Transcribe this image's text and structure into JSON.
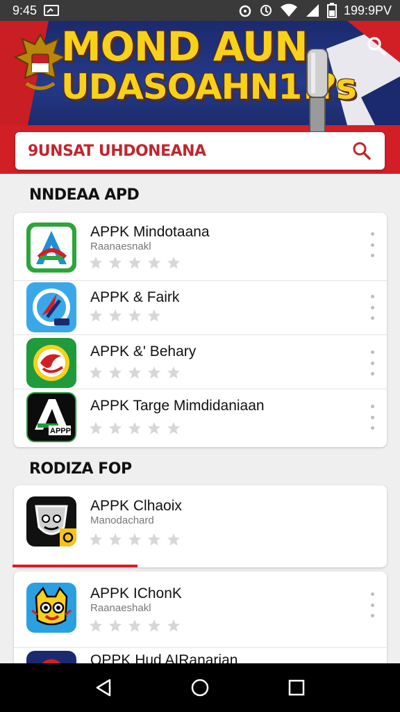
{
  "status_bar": {
    "time": "9:45",
    "battery": "199:9PV"
  },
  "banner": {
    "title_line1": "MOND AUN",
    "title_line2": "UDASOAHN1!?s"
  },
  "search": {
    "value": "9UNSAT UHDONEANA"
  },
  "section1": {
    "title": "NNDEAA APD",
    "apps": [
      {
        "name": "APPK Mindotaana",
        "developer": "Raanaesnakl"
      },
      {
        "name": "APPK & Fairk",
        "developer": ""
      },
      {
        "name": "APPK &' Behary",
        "developer": ""
      },
      {
        "name": "APPK Targe Mimdidaniaan",
        "developer": ""
      }
    ]
  },
  "section2": {
    "title": "RODIZA FOP",
    "apps": [
      {
        "name": "APPK Clhaoix",
        "developer": "Manodachard"
      },
      {
        "name": "APPK IChonK",
        "developer": "Raanaeshakl"
      },
      {
        "name": "OPPK Hud AIRanarian",
        "developer": ""
      }
    ]
  },
  "icons": {
    "app4_badge": "APPP"
  },
  "colors": {
    "brand_red": "#d21f26",
    "banner_yellow": "#f7d11a",
    "banner_navy": "#1b2a6e"
  }
}
